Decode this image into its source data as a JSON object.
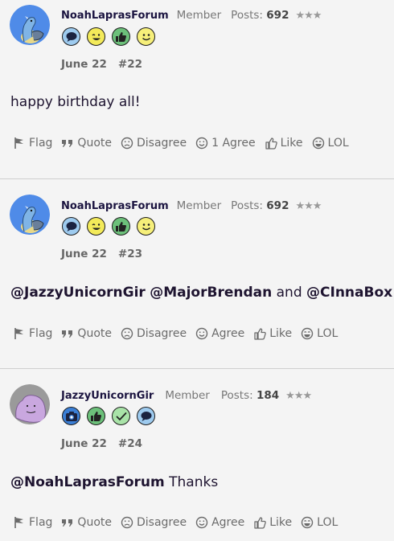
{
  "colors": {
    "background": "#f4f4f4",
    "username": "#1b1440",
    "accent_blue": "#3b7fd6"
  },
  "posts": [
    {
      "username": "NoahLaprasForum",
      "role": "Member",
      "posts_label": "Posts:",
      "posts_count": "692",
      "stars": "★★★",
      "avatar": "lapras-avatar",
      "badges": [
        "speech-bubble-badge",
        "wink-badge",
        "thumbs-up-badge",
        "smile-badge"
      ],
      "date": "June 22",
      "post_number": "#22",
      "content": {
        "text": "happy birthday all!"
      },
      "actions": {
        "flag": "Flag",
        "quote": "Quote",
        "disagree": "Disagree",
        "agree": "1 Agree",
        "like": "Like",
        "lol": "LOL"
      }
    },
    {
      "username": "NoahLaprasForum",
      "role": "Member",
      "posts_label": "Posts:",
      "posts_count": "692",
      "stars": "★★★",
      "avatar": "lapras-avatar",
      "badges": [
        "speech-bubble-badge",
        "wink-badge",
        "thumbs-up-badge",
        "smile-badge"
      ],
      "date": "June 22",
      "post_number": "#23",
      "content": {
        "mention1": "@JazzyUnicornGir",
        "mention2": "@MajorBrendan",
        "joiner": "and",
        "mention3": "@CInnaBox"
      },
      "actions": {
        "flag": "Flag",
        "quote": "Quote",
        "disagree": "Disagree",
        "agree": "Agree",
        "like": "Like",
        "lol": "LOL"
      }
    },
    {
      "username": "JazzyUnicornGir",
      "role": "Member",
      "posts_label": "Posts:",
      "posts_count": "184",
      "stars": "★★★",
      "avatar": "ditto-avatar",
      "badges": [
        "camera-badge",
        "thumbs-up-badge",
        "checkmark-badge",
        "speech-bubble-badge"
      ],
      "date": "June 22",
      "post_number": "#24",
      "content": {
        "mention1": "@NoahLaprasForum",
        "text": "Thanks"
      },
      "actions": {
        "flag": "Flag",
        "quote": "Quote",
        "disagree": "Disagree",
        "agree": "Agree",
        "like": "Like",
        "lol": "LOL"
      }
    }
  ]
}
